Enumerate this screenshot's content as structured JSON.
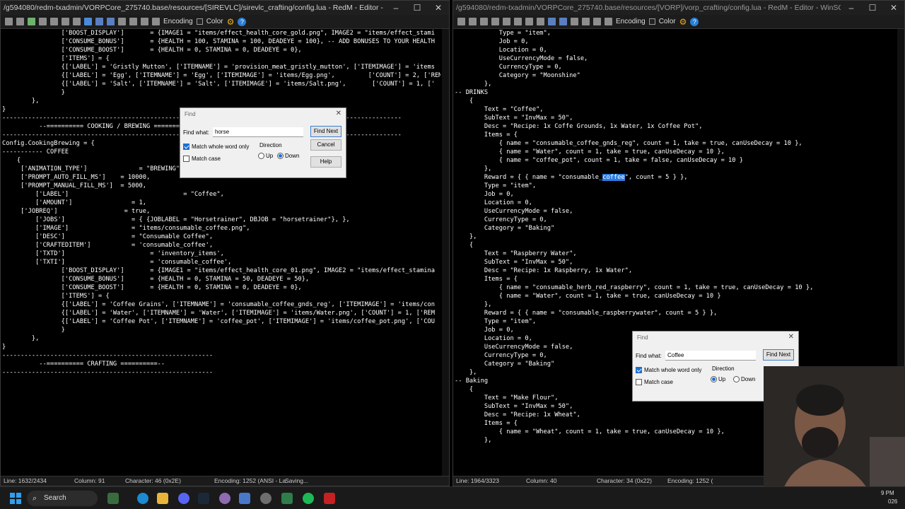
{
  "left_window": {
    "title": "/g594080/redm-txadmin/VORPCore_275740.base/resources/[SIREVLC]/sirevlc_crafting/config.lua - RedM - Editor - WinSCP",
    "toolbar": {
      "encoding": "Encoding",
      "color": "Color"
    },
    "code": [
      "                ['BOOST_DISPLAY']       = {IMAGE1 = \"items/effect_health_core_gold.png\", IMAGE2 = \"items/effect_stami",
      "                ['CONSUME_BONUS']       = {HEALTH = 100, STAMINA = 100, DEADEYE = 100}, -- ADD BONUSES TO YOUR HEALTH",
      "                ['CONSUME_BOOST']       = {HEALTH = 0, STAMINA = 0, DEADEYE = 0},",
      "                ['ITEMS'] = {",
      "                {['LABEL'] = 'Gristly Mutton', ['ITEMNAME'] = 'provision_meat_gristly_mutton', ['ITEMIMAGE'] = 'items",
      "                {['LABEL'] = 'Egg', ['ITEMNAME'] = 'Egg', ['ITEMIMAGE'] = 'items/Egg.png',         ['COUNT'] = 2, ['REM",
      "                {['LABEL'] = 'Salt', ['ITEMNAME'] = 'Salt', ['ITEMIMAGE'] = 'items/Salt.png',       ['COUNT'] = 1, ['",
      "                }",
      "        },",
      "",
      "}",
      "",
      "",
      "------------------------------------------------------------------------------------------------------------",
      "          --========== COOKING / BREWING ==========",
      "------------------------------------------------------------------------------------------------------------",
      "",
      "Config.CookingBrewing = {",
      "----------- COFFEE",
      "    {",
      "     ['ANIMATION_TYPE']              = \"BREWING\", -- TYPE OF ANIMATION PLAYING WHEN CRAFTING",
      "     ['PROMPT_AUTO_FILL_MS']    = 10000,",
      "     ['PROMPT_MANUAL_FILL_MS']  = 5000,",
      "         ['LABEL']                               = \"Coffee\",",
      "         ['AMOUNT']                = 1,",
      "     ['JOBREQ']                  = true,",
      "         ['JOBS']                  = { {JOBLABEL = \"Horsetrainer\", DBJOB = \"horsetrainer\"}, },",
      "         ['IMAGE']                 = \"items/consumable_coffee.png\",",
      "         ['DESC']                  = \"Consumable Coffee\",",
      "         ['CRAFTEDITEM']           = 'consumable_coffee',",
      "         ['TXTD']                       = 'inventory_items',",
      "         ['TXTI']                       = 'consumable_coffee',",
      "                ['BOOST_DISPLAY']       = {IMAGE1 = \"items/effect_health_core_01.png\", IMAGE2 = \"items/effect_stamina",
      "                ['CONSUME_BONUS']       = {HEALTH = 0, STAMINA = 50, DEADEYE = 50},",
      "                ['CONSUME_BOOST']       = {HEALTH = 0, STAMINA = 0, DEADEYE = 0},",
      "                ['ITEMS'] = {",
      "                {['LABEL'] = 'Coffee Grains', ['ITEMNAME'] = 'consumable_coffee_gnds_reg', ['ITEMIMAGE'] = 'items/con",
      "                {['LABEL'] = 'Water', ['ITEMNAME'] = 'Water', ['ITEMIMAGE'] = 'items/Water.png', ['COUNT'] = 1, ['REM",
      "                {['LABEL'] = 'Coffee Pot', ['ITEMNAME'] = 'coffee_pot', ['ITEMIMAGE'] = 'items/coffee_pot.png', ['COU",
      "                }",
      "        },",
      "",
      "}",
      "",
      "",
      "---------------------------------------------------------",
      "          --========== CRAFTING ==========--",
      "---------------------------------------------------------"
    ],
    "status": {
      "line": "Line: 1632/2434",
      "column": "Column: 91",
      "character": "Character: 46 (0x2E)",
      "encoding": "Encoding: 1252 (ANSI - La",
      "state": "Saving..."
    }
  },
  "right_window": {
    "title": "/g594080/redm-txadmin/VORPCore_275740.base/resources/[VORP]/vorp_crafting/config.lua - RedM - Editor - WinSCP",
    "toolbar": {
      "encoding": "Encoding",
      "color": "Color"
    },
    "code": [
      "            Type = \"item\",",
      "            Job = 0,",
      "            Location = 0,",
      "            UseCurrencyMode = false,",
      "            CurrencyType = 0,",
      "            Category = \"Moonshine\"",
      "        },",
      "",
      "-- DRINKS",
      "    {",
      "        Text = \"Coffee\",",
      "        SubText = \"InvMax = 50\",",
      "        Desc = \"Recipe: 1x Coffe Grounds, 1x Water, 1x Coffee Pot\",",
      "        Items = {",
      "            { name = \"consumable_coffee_gnds_reg\", count = 1, take = true, canUseDecay = 10 },",
      "            { name = \"Water\", count = 1, take = true, canUseDecay = 10 },",
      "            { name = \"coffee_pot\", count = 1, take = false, canUseDecay = 10 }",
      "        },",
      "        Reward = { { name = \"consumable_",
      "        Type = \"item\",",
      "        Job = 0,",
      "        Location = 0,",
      "        UseCurrencyMode = false,",
      "        CurrencyType = 0,",
      "        Category = \"Baking\"",
      "    },",
      "    {",
      "        Text = \"Raspberry Water\",",
      "        SubText = \"InvMax = 50\",",
      "        Desc = \"Recipe: 1x Raspberry, 1x Water\",",
      "        Items = {",
      "            { name = \"consumable_herb_red_raspberry\", count = 1, take = true, canUseDecay = 10 },",
      "            { name = \"Water\", count = 1, take = true, canUseDecay = 10 }",
      "        },",
      "        Reward = { { name = \"consumable_raspberrywater\", count = 5 } },",
      "        Type = \"item\",",
      "        Job = 0,",
      "        Location = 0,",
      "        UseCurrencyMode = false,",
      "        CurrencyType = 0,",
      "        Category = \"Baking\"",
      "    },",
      "",
      "-- Baking",
      "    {",
      "        Text = \"Make Flour\",",
      "        SubText = \"InvMax = 50\",",
      "        Desc = \"Recipe: 1x Wheat\",",
      "        Items = {",
      "            { name = \"Wheat\", count = 1, take = true, canUseDecay = 10 },",
      "        },"
    ],
    "highlight_word": "coffee",
    "highlight_rest": "\", count = 5 } },",
    "status": {
      "line": "Line: 1964/3323",
      "column": "Column: 40",
      "character": "Character: 34 (0x22)",
      "encoding": "Encoding: 1252 ("
    }
  },
  "find_left": {
    "title": "Find",
    "find_what_label": "Find what:",
    "value": "horse",
    "match_whole": "Match whole word only",
    "match_case": "Match case",
    "direction": "Direction",
    "up": "Up",
    "down": "Down",
    "find_next": "Find Next",
    "cancel": "Cancel",
    "help": "Help"
  },
  "find_right": {
    "title": "Find",
    "find_what_label": "Find what:",
    "value": "Coffee",
    "match_whole": "Match whole word only",
    "match_case": "Match case",
    "direction": "Direction",
    "up": "Up",
    "down": "Down",
    "find_next": "Find Next"
  },
  "taskbar": {
    "search": "Search",
    "time": "9 PM",
    "date": "026"
  }
}
